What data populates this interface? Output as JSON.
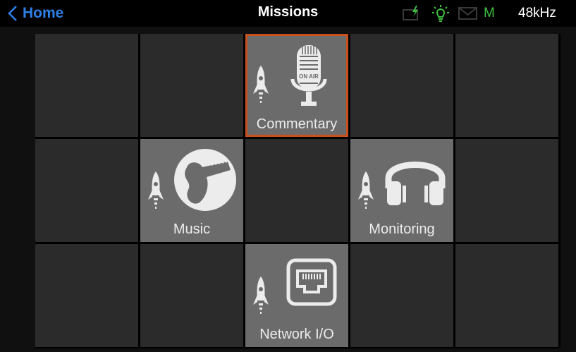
{
  "header": {
    "back_label": "Home",
    "title": "Missions",
    "status": {
      "battery_icon": "battery-charging-icon",
      "bulb_icon": "lightbulb-icon",
      "mail_icon": "mail-icon",
      "mode_flag": "M",
      "sample_rate": "48kHz"
    }
  },
  "colors": {
    "accent_blue": "#2e7fe6",
    "selected_border": "#c8501c",
    "status_green": "#3fbf3f",
    "tile_active": "#6b6b6b",
    "tile_empty": "#2b2b2b"
  },
  "missions": {
    "commentary": {
      "label": "Commentary",
      "icon": "microphone-on-air-icon",
      "selected": true
    },
    "music": {
      "label": "Music",
      "icon": "guitar-icon",
      "selected": false
    },
    "monitoring": {
      "label": "Monitoring",
      "icon": "headphones-icon",
      "selected": false
    },
    "network": {
      "label": "Network I/O",
      "icon": "ethernet-port-icon",
      "selected": false
    },
    "mic_badge": "ON AIR"
  }
}
